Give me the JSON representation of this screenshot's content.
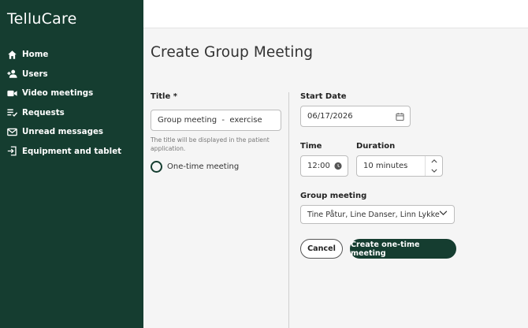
{
  "app": {
    "brand": "TelluCare"
  },
  "sidebar": {
    "items": [
      {
        "label": "Home",
        "icon": "home-icon"
      },
      {
        "label": "Users",
        "icon": "users-icon"
      },
      {
        "label": "Video meetings",
        "icon": "video-camera-icon"
      },
      {
        "label": "Requests",
        "icon": "requests-list-icon"
      },
      {
        "label": "Unread messages",
        "icon": "envelope-icon"
      },
      {
        "label": "Equipment and tablet",
        "icon": "tablet-login-icon"
      }
    ]
  },
  "page": {
    "title": "Create Group Meeting"
  },
  "form": {
    "title_label": "Title *",
    "title_value": "Group meeting  -  exercise",
    "title_helper": "The title will be displayed in the patient application.",
    "one_time_label": "One-time meeting",
    "start_date_label": "Start Date",
    "start_date_value": "06/17/2026",
    "time_label": "Time",
    "time_value": "12:00",
    "duration_label": "Duration",
    "duration_value": "10  minutes",
    "group_label": "Group meeting",
    "group_value": "Tine Påtur, Line Danser, Linn Lykke"
  },
  "actions": {
    "cancel_label": "Cancel",
    "create_label": "Create one-time meeting"
  },
  "colors": {
    "primary": "#153d30",
    "background": "#f5f5f5"
  }
}
